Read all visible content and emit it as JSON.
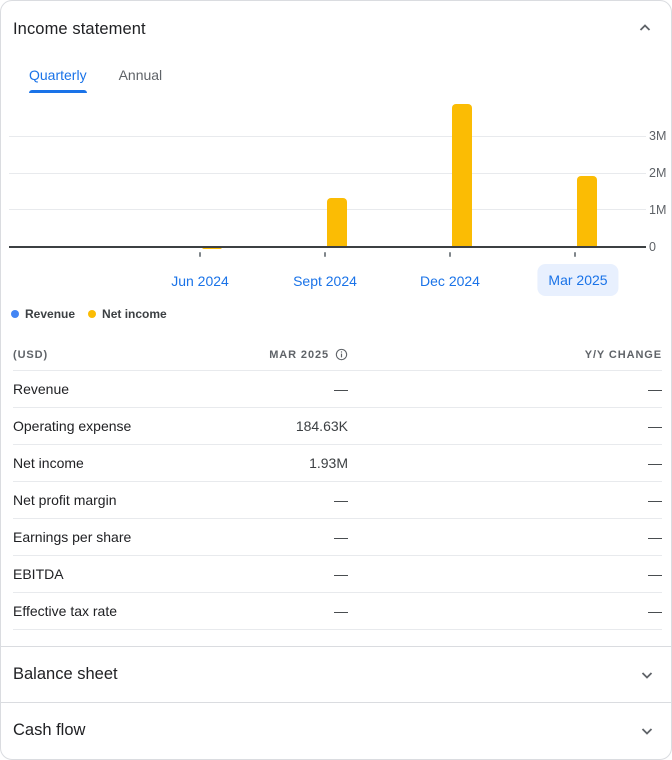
{
  "header": {
    "title": "Income statement",
    "collapse_icon": "chevron-up-icon"
  },
  "tabs": [
    {
      "label": "Quarterly",
      "active": true
    },
    {
      "label": "Annual",
      "active": false
    }
  ],
  "chart_data": {
    "type": "bar",
    "categories": [
      "Jun 2024",
      "Sept 2024",
      "Dec 2024",
      "Mar 2025"
    ],
    "selected_category": "Mar 2025",
    "series": [
      {
        "name": "Revenue",
        "color": "#4285f4",
        "values": [
          null,
          null,
          null,
          null
        ]
      },
      {
        "name": "Net income",
        "color": "#fbbc04",
        "values": [
          -0.03,
          1.33,
          3.88,
          1.93
        ]
      }
    ],
    "unit": "M",
    "ylim": [
      -0.1,
      4.1
    ],
    "yticks": [
      {
        "label": "0",
        "value": 0
      },
      {
        "label": "1M",
        "value": 1
      },
      {
        "label": "2M",
        "value": 2
      },
      {
        "label": "3M",
        "value": 3
      }
    ],
    "grid": true,
    "legend_position": "bottom-left"
  },
  "table": {
    "unit_label": "(USD)",
    "period_label": "MAR 2025",
    "change_label": "Y/Y CHANGE",
    "rows": [
      {
        "label": "Revenue",
        "value": "—",
        "change": "—"
      },
      {
        "label": "Operating expense",
        "value": "184.63K",
        "change": "—"
      },
      {
        "label": "Net income",
        "value": "1.93M",
        "change": "—"
      },
      {
        "label": "Net profit margin",
        "value": "—",
        "change": "—"
      },
      {
        "label": "Earnings per share",
        "value": "—",
        "change": "—"
      },
      {
        "label": "EBITDA",
        "value": "—",
        "change": "—"
      },
      {
        "label": "Effective tax rate",
        "value": "—",
        "change": "—"
      }
    ]
  },
  "sections": [
    {
      "label": "Balance sheet"
    },
    {
      "label": "Cash flow"
    }
  ],
  "colors": {
    "accent_blue": "#1a73e8",
    "bar_yellow": "#fbbc04",
    "legend_blue": "#4285f4",
    "selected_chip_bg": "#e8f0fe",
    "text_primary": "#202124",
    "text_secondary": "#5f6368",
    "divider": "#e8eaed",
    "card_border": "#dadce0",
    "axis": "#3c4043"
  }
}
